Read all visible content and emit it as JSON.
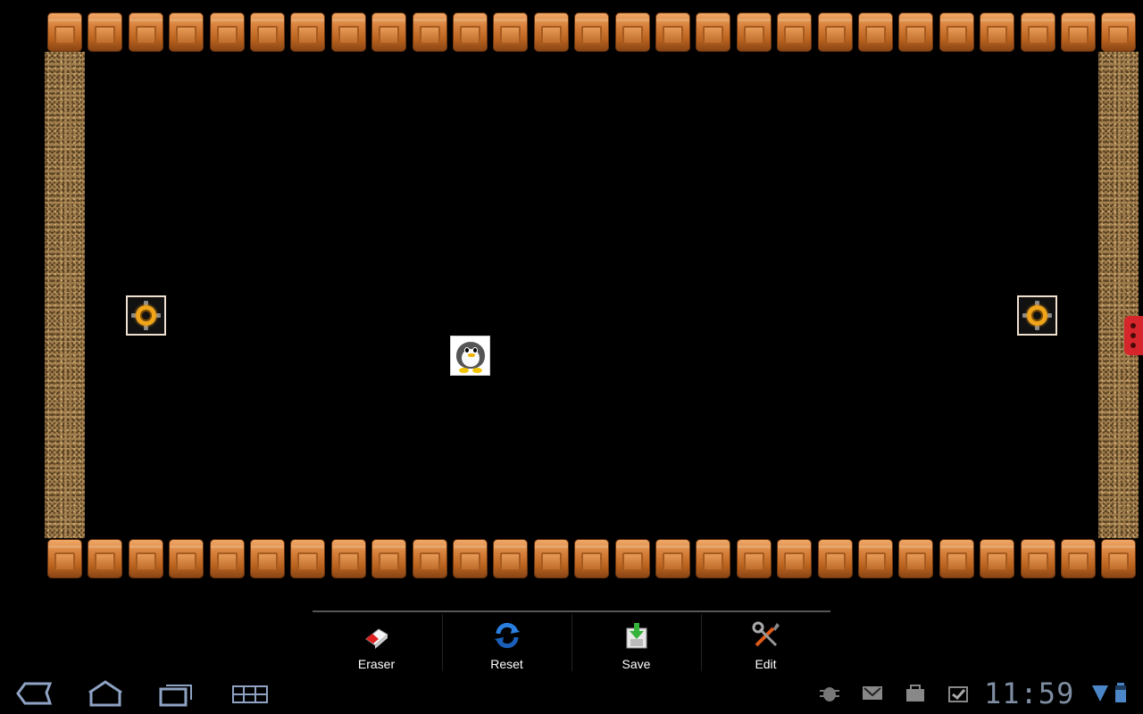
{
  "board": {
    "top_bricks": 27,
    "bottom_bricks": 27,
    "tiles": [
      {
        "kind": "portal",
        "name": "portal-left"
      },
      {
        "kind": "portal",
        "name": "portal-right"
      },
      {
        "kind": "penguin",
        "name": "penguin-player"
      }
    ]
  },
  "toolbar": {
    "items": [
      {
        "id": "eraser",
        "label": "Eraser",
        "icon": "eraser-icon"
      },
      {
        "id": "reset",
        "label": "Reset",
        "icon": "reset-icon"
      },
      {
        "id": "save",
        "label": "Save",
        "icon": "save-icon"
      },
      {
        "id": "edit",
        "label": "Edit",
        "icon": "edit-tools-icon"
      }
    ]
  },
  "system_bar": {
    "nav": [
      "back-icon",
      "home-icon",
      "recent-apps-icon",
      "menu-grid-icon"
    ],
    "notifications": [
      "debug-bug-icon",
      "gmail-icon",
      "market-bag-icon",
      "download-complete-icon"
    ],
    "clock": "11:59",
    "status_icons": [
      "wifi-signal-icon",
      "battery-icon"
    ]
  },
  "colors": {
    "accent_clock": "#7f8ea3",
    "brick": "#c06c2a",
    "sand": "#9c7a49",
    "handle": "#d6262b"
  }
}
